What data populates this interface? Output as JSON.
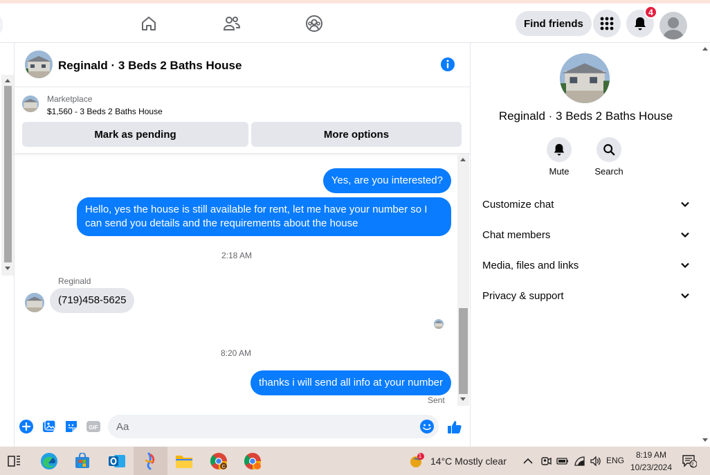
{
  "topbar": {
    "nav_icons": [
      "home-icon",
      "friends-icon",
      "groups-icon"
    ],
    "find_friends_label": "Find friends",
    "notification_count": "4"
  },
  "chat": {
    "title": "Reginald · 3 Beds 2 Baths House",
    "marketplace_label": "Marketplace",
    "listing": "$1,560 - 3 Beds 2 Baths House",
    "mark_pending_label": "Mark as pending",
    "more_options_label": "More options"
  },
  "messages": {
    "out1": "Yes, are you interested?",
    "out2": "Hello, yes the house is still available for rent, let me have your number so I can send you details and the requirements about the house",
    "time1": "2:18 AM",
    "sender_name": "Reginald",
    "in1": "(719)458-5625",
    "time2": "8:20 AM",
    "out3": "thanks i will send all info at your number",
    "status": "Sent"
  },
  "composer": {
    "placeholder": "Aa"
  },
  "right_panel": {
    "name": "Reginald · 3 Beds 2 Baths House",
    "mute_label": "Mute",
    "search_label": "Search",
    "sections": [
      "Customize chat",
      "Chat members",
      "Media, files and links",
      "Privacy & support"
    ]
  },
  "taskbar": {
    "weather": "14°C  Mostly clear",
    "weather_badge": "1",
    "language": "ENG",
    "time": "8:19 AM",
    "date": "10/23/2024",
    "notification_count": "2"
  },
  "colors": {
    "accent": "#0a7cff",
    "badge": "#e41e3f"
  }
}
